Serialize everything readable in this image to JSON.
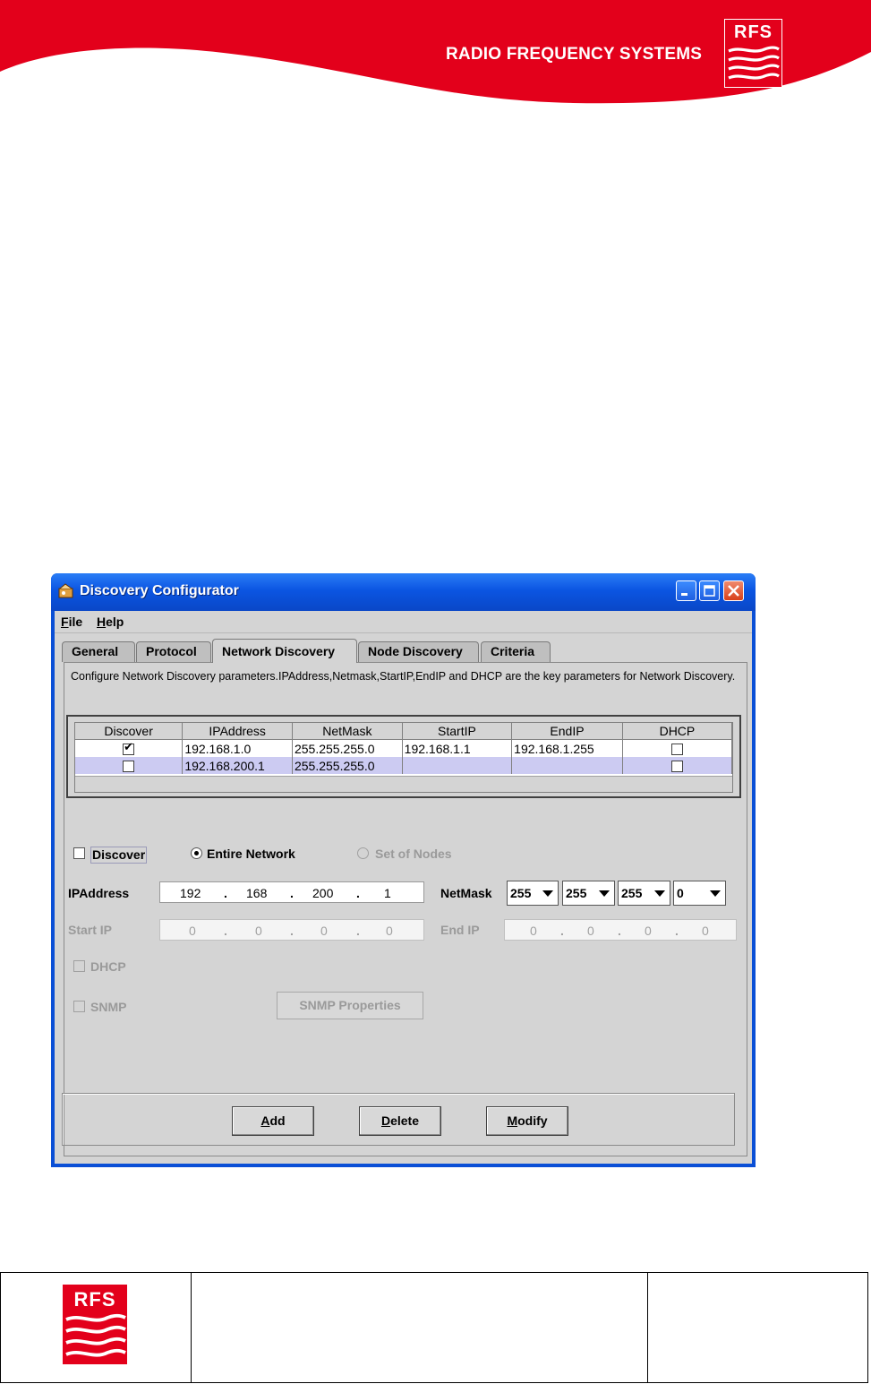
{
  "header": {
    "company_name": "RADIO FREQUENCY SYSTEMS",
    "logo_text": "RFS",
    "brand_color": "#e3001b"
  },
  "window": {
    "title": "Discovery Configurator",
    "menu": [
      {
        "label_mnemonic": "F",
        "label_rest": "ile"
      },
      {
        "label_mnemonic": "H",
        "label_rest": "elp"
      }
    ],
    "tabs": [
      "General",
      "Protocol",
      "Network Discovery",
      "Node Discovery",
      "Criteria"
    ],
    "active_tab": "Network Discovery",
    "description": "Configure Network Discovery parameters.IPAddress,Netmask,StartIP,EndIP and DHCP are the key parameters for Network Discovery.",
    "table": {
      "columns": [
        "Discover",
        "IPAddress",
        "NetMask",
        "StartIP",
        "EndIP",
        "DHCP"
      ],
      "rows": [
        {
          "discover": true,
          "ip": "192.168.1.0",
          "netmask": "255.255.255.0",
          "start_ip": "192.168.1.1",
          "end_ip": "192.168.1.255",
          "dhcp": false
        },
        {
          "discover": false,
          "ip": "192.168.200.1",
          "netmask": "255.255.255.0",
          "start_ip": "",
          "end_ip": "",
          "dhcp": false
        }
      ]
    },
    "form": {
      "discover_label": "Discover",
      "entire_network_label": "Entire Network",
      "set_of_nodes_label": "Set of Nodes",
      "ipaddress_label": "IPAddress",
      "ip_octets": [
        "192",
        "168",
        "200",
        "1"
      ],
      "netmask_label": "NetMask",
      "netmask_octets": [
        "255",
        "255",
        "255",
        "0"
      ],
      "start_ip_label": "Start IP",
      "start_ip_octets": [
        "0",
        "0",
        "0",
        "0"
      ],
      "end_ip_label": "End IP",
      "end_ip_octets": [
        "0",
        "0",
        "0",
        "0"
      ],
      "dhcp_label": "DHCP",
      "snmp_label": "SNMP",
      "snmp_properties_label": "SNMP Properties",
      "dot": "."
    },
    "buttons": {
      "add": {
        "mnemonic": "A",
        "rest": "dd"
      },
      "delete": {
        "mnemonic": "D",
        "rest": "elete"
      },
      "modify": {
        "mnemonic": "M",
        "rest": "odify"
      }
    }
  }
}
